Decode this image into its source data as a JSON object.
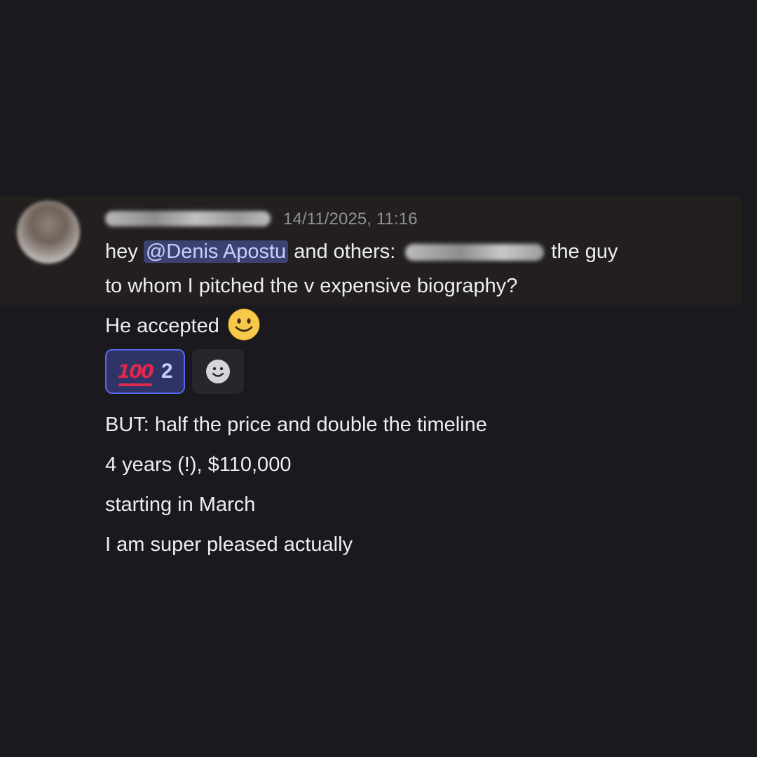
{
  "message": {
    "timestamp": "14/11/2025, 11:16",
    "lines": {
      "l1_prefix": "hey ",
      "mention": "@Denis Apostu",
      "l1_middle": " and others: ",
      "l1_suffix": " the guy",
      "l2": "to whom I pitched the v expensive biography?",
      "l3": "He accepted",
      "l4": "BUT: half the price and double the timeline",
      "l5": "4 years (!), $110,000",
      "l6": "starting in March",
      "l7": "I am super pleased actually"
    },
    "emoji_icon": "slightly-smiling-face-icon"
  },
  "reactions": [
    {
      "icon": "hundred-points-icon",
      "glyph": "100",
      "count": "2",
      "selected": true
    },
    {
      "icon": "add-reaction-icon"
    }
  ],
  "colors": {
    "background": "#1a1a1e",
    "highlight": "#231f1f",
    "mention_bg": "#3c4270",
    "mention_text": "#c9cdfb",
    "reaction_selected_bg": "#2f3467",
    "reaction_selected_border": "#5865f2"
  }
}
